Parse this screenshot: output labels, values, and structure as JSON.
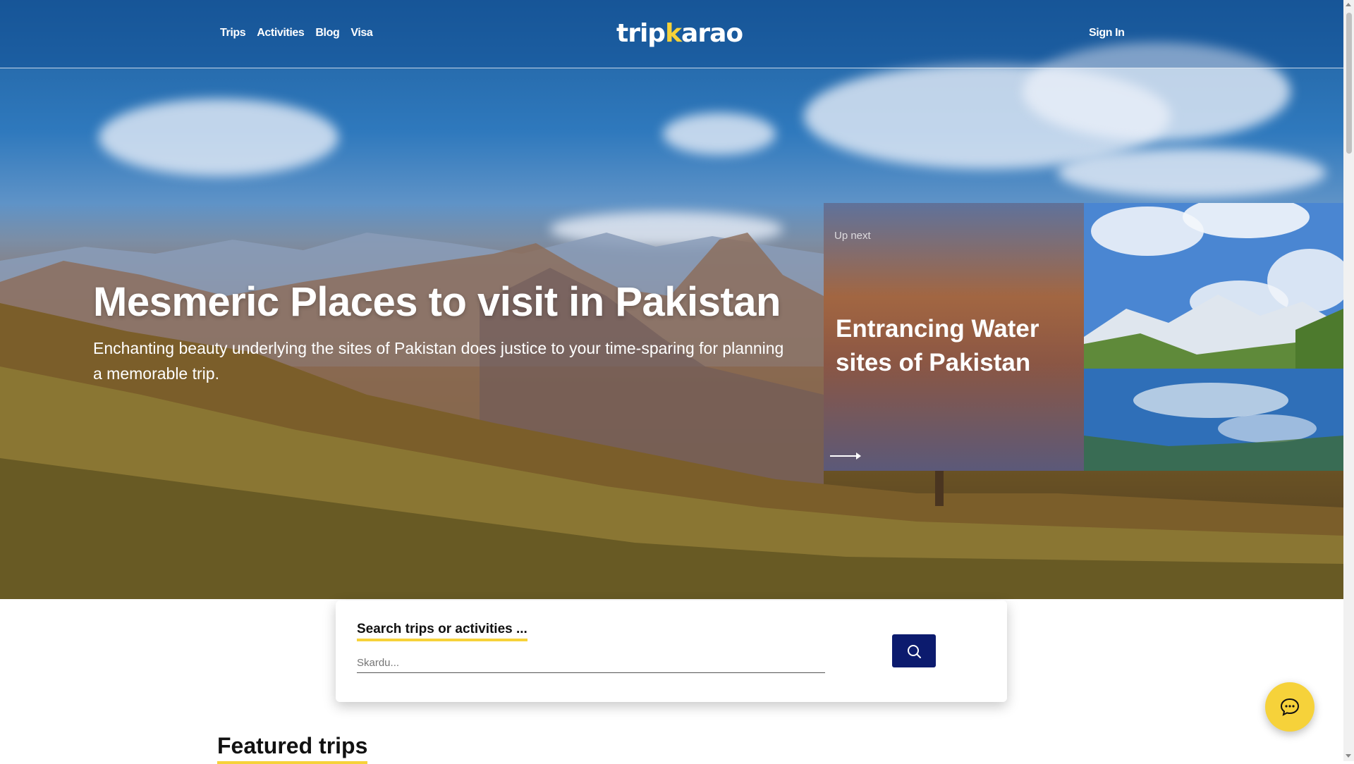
{
  "nav": {
    "links": [
      {
        "label": "Trips"
      },
      {
        "label": "Activities"
      },
      {
        "label": "Blog"
      },
      {
        "label": "Visa"
      }
    ],
    "logo": {
      "before": "trip",
      "accent": "k",
      "after": "arao"
    },
    "sign_in": "Sign In"
  },
  "hero": {
    "title": "Mesmeric Places to visit in Pakistan",
    "subtitle": "Enchanting beauty underlying the sites of Pakistan does justice to your time-sparing for planning a memorable trip."
  },
  "up_next": {
    "label": "Up next",
    "title": "Entrancing Water sites of Pakistan",
    "arrow_icon": "long-arrow-right-icon"
  },
  "search": {
    "label": "Search trips or activities ...",
    "placeholder": "Skardu...",
    "value": "",
    "button_icon": "search-icon"
  },
  "featured": {
    "title": "Featured trips"
  },
  "chat": {
    "icon": "chat-bubble-icon"
  },
  "colors": {
    "accent_yellow": "#f6d23a",
    "navy": "#0c1b6e",
    "header_blue": "#1f5f9e"
  }
}
